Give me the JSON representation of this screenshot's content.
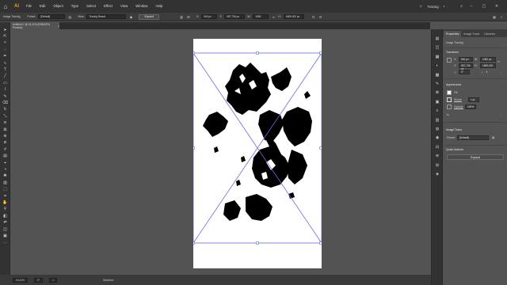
{
  "app": {
    "logo": "Ai"
  },
  "menu": [
    "File",
    "Edit",
    "Object",
    "Type",
    "Select",
    "Effect",
    "View",
    "Window",
    "Help"
  ],
  "workspace": "Tracing",
  "control_bar": {
    "mode_label": "Image Tracing",
    "preset_label": "Preset:",
    "preset_value": "[Default]",
    "view_label": "View:",
    "view_value": "Tracing Result",
    "expand_button": "Expand",
    "x_value": "540 px",
    "y_value": "957,736 px",
    "w_value": "1080",
    "h_value": "1689,002 px"
  },
  "doc_tab": {
    "title": "Untitled-1* @ 24,11% (RGB/GPU Preview)",
    "close": "×"
  },
  "status_bar": {
    "zoom": "24,11%",
    "rotate": "0°",
    "page": "1",
    "mode": "Selection"
  },
  "panel": {
    "tabs": [
      "Properties",
      "Image Trace",
      "Libraries"
    ],
    "active_tab": "Properties",
    "object_type": "Image Tracing",
    "transform_title": "Transform",
    "x": "540 px",
    "y": "957,736 px",
    "w": "1080 px",
    "h": "1689,002",
    "angle": "0°",
    "appearance_title": "Appearance",
    "fill_label": "Fill",
    "stroke_label": "Stroke",
    "stroke_value": "1 pt",
    "opacity_label": "Opacity",
    "opacity_value": "100%",
    "image_trace_title": "Image Trace",
    "preset_label": "Preset:",
    "preset_value": "[Default]",
    "quick_actions_title": "Quick Actions",
    "expand_button": "Expand"
  },
  "colors": {
    "app_bg": "#535353",
    "menubar": "#323232",
    "panel": "#535353",
    "selection": "#6a6adf",
    "artboard": "#ffffff"
  }
}
